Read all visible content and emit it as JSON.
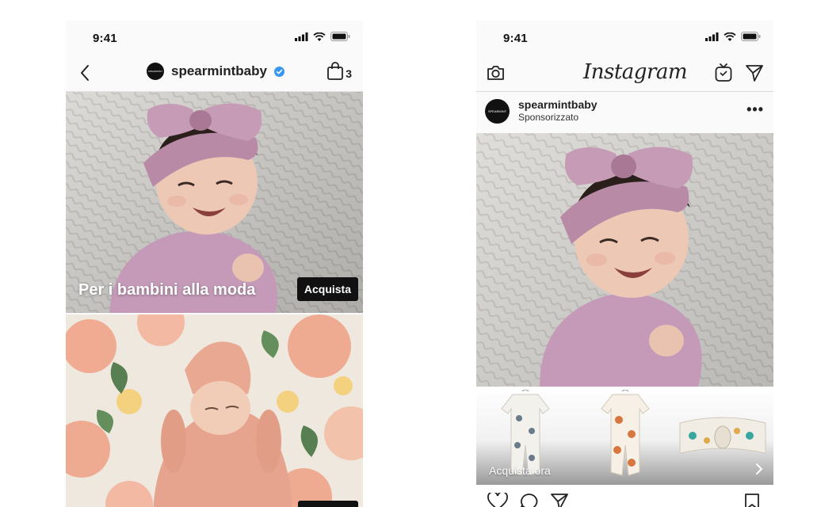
{
  "left_phone": {
    "status_time": "9:41",
    "header": {
      "username": "spearmintbaby",
      "cart_count": "3",
      "avatar_text": "SPEARMINT"
    },
    "tile1": {
      "caption": "Per i bambini alla moda",
      "button_label": "Acquista"
    }
  },
  "right_phone": {
    "status_time": "9:41",
    "app_title": "Instagram",
    "post": {
      "username": "spearmintbaby",
      "subtitle": "Sponsorizzato",
      "avatar_text": "SPEARMINT",
      "more": "•••",
      "cta": "Acquista ora"
    }
  },
  "colors": {
    "verified": "#3897f0",
    "headband_pink": "#b98aa6",
    "romper_pink": "#c49ab8",
    "blanket_white": "#eceae6"
  },
  "icons": [
    "chevron-left-icon",
    "verified-icon",
    "shopping-bag-icon",
    "camera-icon",
    "igtv-icon",
    "direct-message-icon",
    "heart-icon",
    "comment-icon",
    "share-icon",
    "bookmark-icon",
    "chevron-right-icon",
    "signal-icon",
    "wifi-icon",
    "battery-icon"
  ]
}
